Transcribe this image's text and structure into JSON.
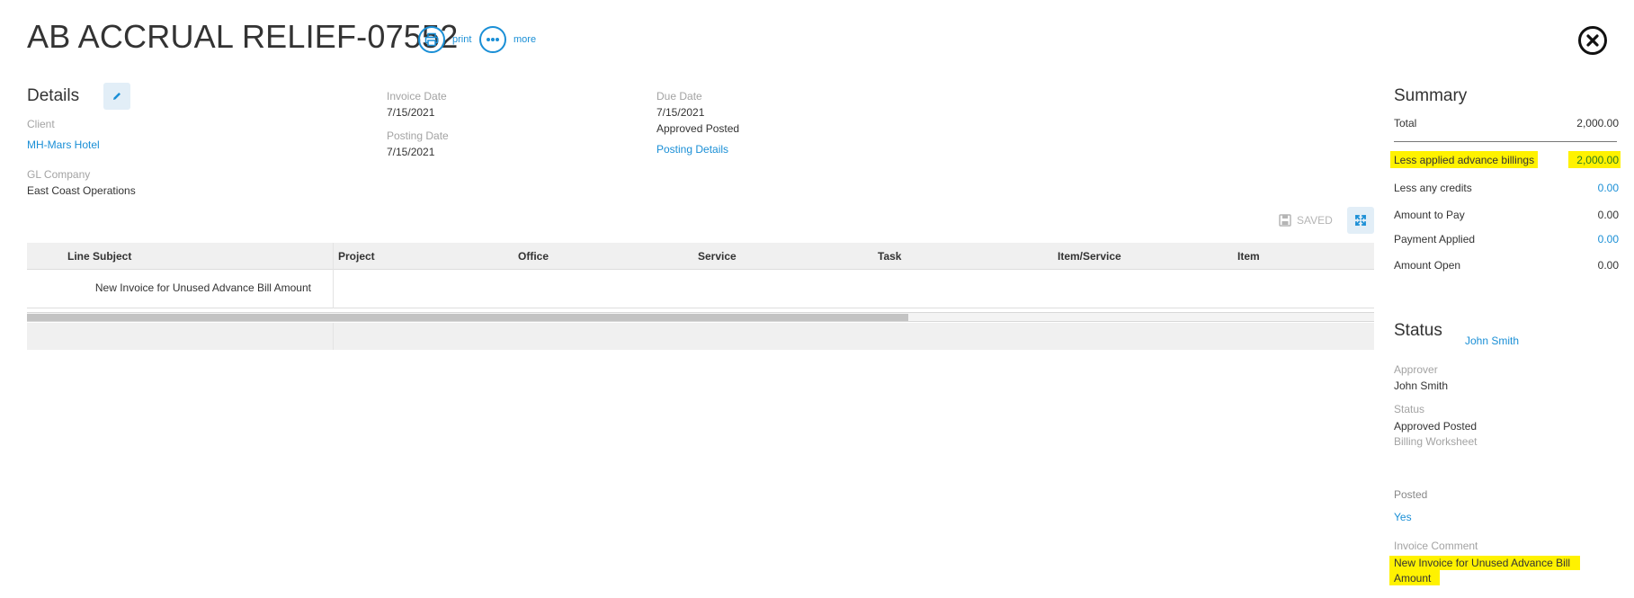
{
  "header": {
    "title": "AB ACCRUAL RELIEF-07552",
    "print_label": "print",
    "more_label": "more"
  },
  "details": {
    "heading": "Details",
    "client_label": "Client",
    "client_value": "MH-Mars Hotel",
    "gl_company_label": "GL Company",
    "gl_company_value": "East Coast Operations",
    "invoice_date_label": "Invoice Date",
    "invoice_date_value": "7/15/2021",
    "posting_date_label": "Posting Date",
    "posting_date_value": "7/15/2021",
    "due_date_label": "Due Date",
    "due_date_value": "7/15/2021",
    "status_value": "Approved Posted",
    "posting_details_link": "Posting Details"
  },
  "toolbar": {
    "saved_label": "SAVED"
  },
  "grid": {
    "columns": [
      "Line Subject",
      "Project",
      "Office",
      "Service",
      "Task",
      "Item/Service",
      "Item"
    ],
    "rows": [
      {
        "line_subject": "New Invoice for Unused Advance Bill Amount"
      }
    ]
  },
  "summary": {
    "heading": "Summary",
    "total_label": "Total",
    "total_value": "2,000.00",
    "less_advance_label": "Less applied advance billings",
    "less_advance_value": "2,000.00",
    "less_credits_label": "Less any credits",
    "less_credits_value": "0.00",
    "amount_to_pay_label": "Amount to Pay",
    "amount_to_pay_value": "0.00",
    "payment_applied_label": "Payment Applied",
    "payment_applied_value": "0.00",
    "amount_open_label": "Amount Open",
    "amount_open_value": "0.00"
  },
  "status": {
    "heading": "Status",
    "owner_link": "John Smith",
    "approver_label": "Approver",
    "approver_value": "John Smith",
    "status_label": "Status",
    "status_value": "Approved Posted",
    "billing_worksheet": "Billing Worksheet",
    "posted_label": "Posted",
    "posted_value": "Yes",
    "invoice_comment_label": "Invoice Comment",
    "invoice_comment_line1": "New Invoice for Unused Advance Bill",
    "invoice_comment_line2": "Amount"
  },
  "colors": {
    "accent": "#1a8fd6",
    "highlight": "#fff200"
  },
  "icons": {
    "print": "printer-icon",
    "more": "ellipsis-icon",
    "close": "close-icon",
    "edit": "pencil-icon",
    "saved": "save-icon",
    "expand": "expand-icon"
  }
}
